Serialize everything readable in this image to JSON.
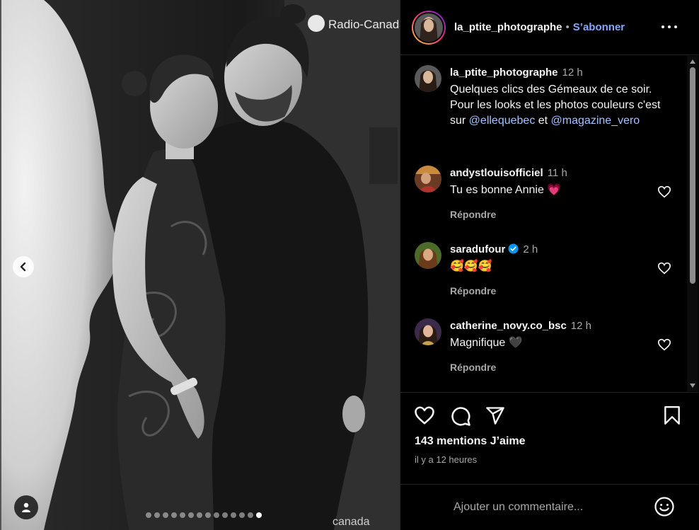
{
  "header": {
    "username": "la_ptite_photographe",
    "separator": "•",
    "follow_label": "S’abonner"
  },
  "photo": {
    "backdrop_logo_text": "Radio-Canada",
    "backdrop_logo_text_bottom": "canada",
    "carousel_total": 14,
    "carousel_active": 14
  },
  "caption": {
    "username": "la_ptite_photographe",
    "time": "12 h",
    "text_before": "Quelques clics des Gémeaux de ce soir. Pour les looks et les photos couleurs c'est sur ",
    "mention1": "@ellequebec",
    "text_middle": " et ",
    "mention2": "@magazine_vero"
  },
  "comments": [
    {
      "username": "andystlouisofficiel",
      "time": "11 h",
      "text": "Tu es bonne Annie",
      "emoji": "💗",
      "reply_label": "Répondre",
      "verified": false
    },
    {
      "username": "saradufour",
      "time": "2 h",
      "text": "",
      "emoji": "🥰🥰🥰",
      "reply_label": "Répondre",
      "verified": true
    },
    {
      "username": "catherine_novy.co_bsc",
      "time": "12 h",
      "text": "Magnifique",
      "emoji": "🖤",
      "reply_label": "Répondre",
      "verified": false
    }
  ],
  "stats": {
    "likes": "143 mentions J’aime",
    "posted_ago": "il y a 12 heures"
  },
  "composer": {
    "placeholder": "Ajouter un commentaire..."
  },
  "icons": {
    "like": "heart-icon",
    "comment": "comment-icon",
    "share": "share-icon",
    "save": "bookmark-icon",
    "emoji": "emoji-icon",
    "more": "more-icon",
    "prev": "chevron-left-icon",
    "tag": "user-tag-icon",
    "verified": "verified-badge-icon"
  },
  "colors": {
    "accent_link": "#85a7ff",
    "mention": "#a5c2ff",
    "verified": "#0095f6",
    "heart_emoji": "#ff3e7a"
  }
}
